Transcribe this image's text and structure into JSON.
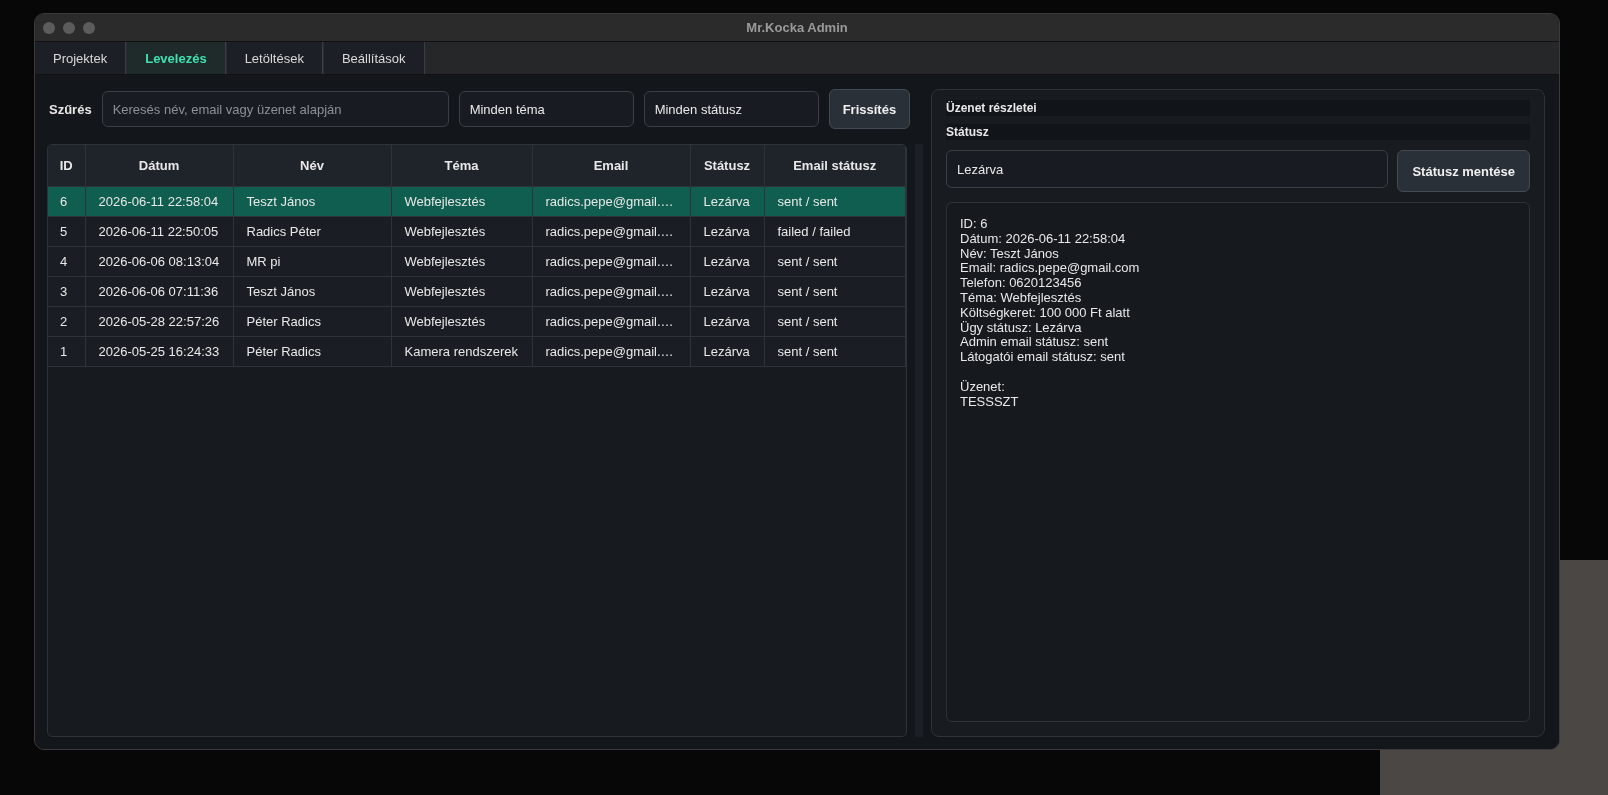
{
  "window": {
    "title": "Mr.Kocka Admin"
  },
  "tabs": [
    {
      "label": "Projektek",
      "selected": false
    },
    {
      "label": "Levelezés",
      "selected": true
    },
    {
      "label": "Letöltések",
      "selected": false
    },
    {
      "label": "Beállítások",
      "selected": false
    }
  ],
  "filter": {
    "label": "Szűrés",
    "search_placeholder": "Keresés név, email vagy üzenet alapján",
    "topic": "Minden téma",
    "status": "Minden státusz",
    "refresh_button": "Frissítés"
  },
  "table": {
    "columns": [
      "ID",
      "Dátum",
      "Név",
      "Téma",
      "Email",
      "Státusz",
      "Email státusz"
    ],
    "rows": [
      {
        "cells": [
          "6",
          "2026-06-11 22:58:04",
          "Teszt János",
          "Webfejlesztés",
          "radics.pepe@gmail.…",
          "Lezárva",
          "sent / sent"
        ],
        "selected": true
      },
      {
        "cells": [
          "5",
          "2026-06-11 22:50:05",
          "Radics Péter",
          "Webfejlesztés",
          "radics.pepe@gmail.…",
          "Lezárva",
          "failed / failed"
        ],
        "selected": false
      },
      {
        "cells": [
          "4",
          "2026-06-06 08:13:04",
          "MR pi",
          "Webfejlesztés",
          "radics.pepe@gmail.…",
          "Lezárva",
          "sent / sent"
        ],
        "selected": false
      },
      {
        "cells": [
          "3",
          "2026-06-06 07:11:36",
          "Teszt János",
          "Webfejlesztés",
          "radics.pepe@gmail.…",
          "Lezárva",
          "sent / sent"
        ],
        "selected": false
      },
      {
        "cells": [
          "2",
          "2026-05-28 22:57:26",
          "Péter Radics",
          "Webfejlesztés",
          "radics.pepe@gmail.…",
          "Lezárva",
          "sent / sent"
        ],
        "selected": false
      },
      {
        "cells": [
          "1",
          "2026-05-25 16:24:33",
          "Péter Radics",
          "Kamera rendszerek",
          "radics.pepe@gmail.…",
          "Lezárva",
          "sent / sent"
        ],
        "selected": false
      }
    ]
  },
  "details": {
    "title": "Üzenet részletei",
    "status_label": "Státusz",
    "status_value": "Lezárva",
    "save_button": "Státusz mentése",
    "lines": [
      "ID: 6",
      "Dátum: 2026-06-11 22:58:04",
      "Név: Teszt János",
      "Email: radics.pepe@gmail.com",
      "Telefon: 0620123456",
      "Téma: Webfejlesztés",
      "Költségkeret: 100 000 Ft alatt",
      "Ügy státusz: Lezárva",
      "Admin email státusz: sent",
      "Látogatói email státusz: sent"
    ],
    "message_label": "Üzenet:",
    "message": "TESSSZT"
  }
}
